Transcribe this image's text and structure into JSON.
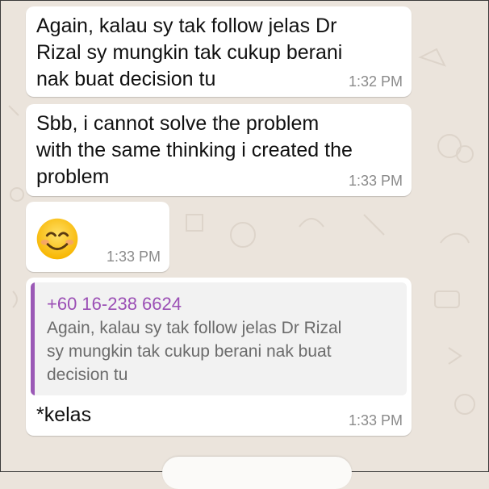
{
  "messages": [
    {
      "text": "Again, kalau sy tak follow jelas Dr\nRizal sy mungkin tak cukup berani\nnak buat decision tu",
      "time": "1:32 PM"
    },
    {
      "text": "Sbb, i cannot solve the problem\nwith the same thinking i created the\nproblem",
      "time": "1:33 PM"
    },
    {
      "emoji": "smiling-face-with-smiling-eyes",
      "time": "1:33 PM"
    },
    {
      "quote": {
        "author": "+60 16-238 6624",
        "text": "Again, kalau sy tak follow jelas Dr Rizal\nsy mungkin tak cukup berani nak buat\ndecision tu"
      },
      "text": "*kelas",
      "time": "1:33 PM"
    }
  ],
  "colors": {
    "chat_background": "#ebe4dc",
    "bubble": "#ffffff",
    "quote_accent": "#9b59b6",
    "quote_author": "#9b4fb5",
    "timestamp": "#8a8a8a"
  }
}
